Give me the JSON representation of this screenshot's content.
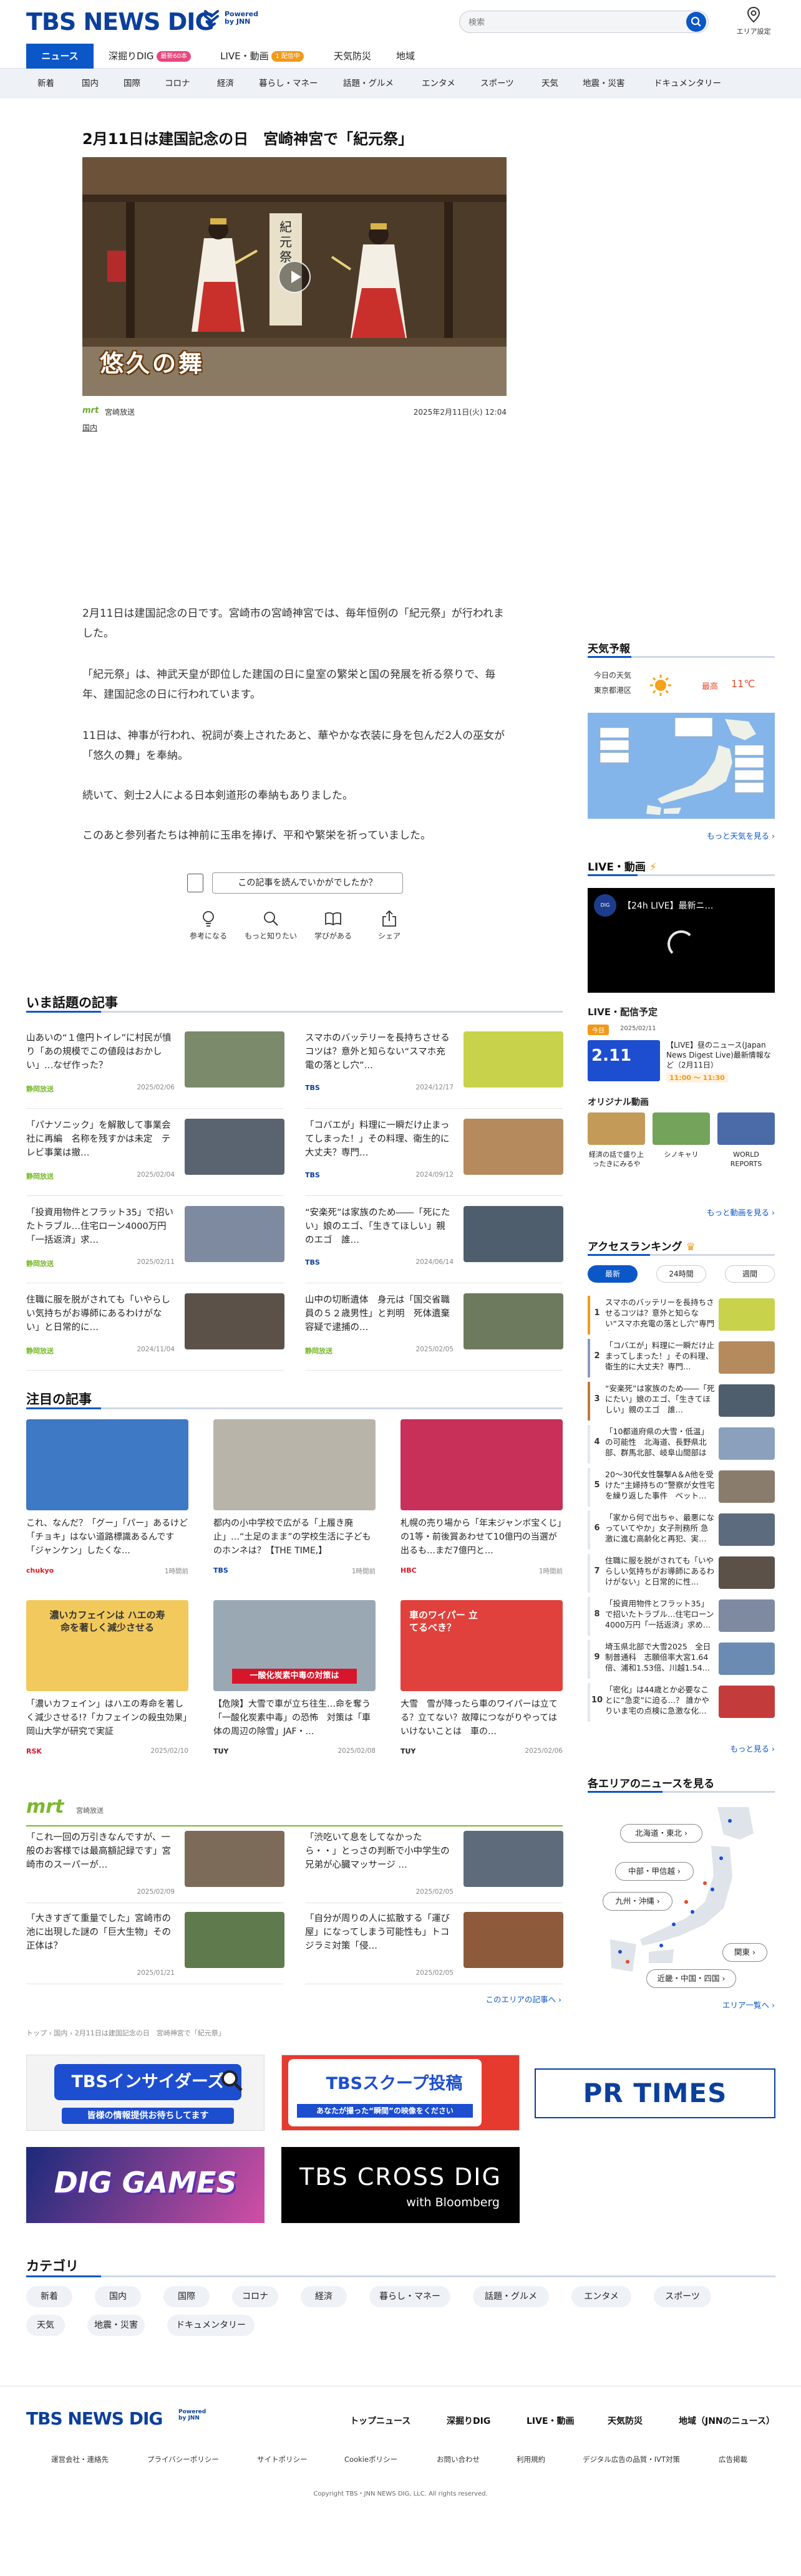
{
  "header": {
    "logo_text": "TBS NEWS DIG",
    "powered_by": "Powered by JNN",
    "search_placeholder": "検索",
    "area_label": "エリア設定"
  },
  "main_nav": [
    {
      "label": "ニュース"
    },
    {
      "label": "深掘りDIG",
      "badge": "最新60本",
      "badge_color": "#e8467c"
    },
    {
      "label": "LIVE・動画",
      "badge": "1 配信中",
      "badge_color": "#f09a1c"
    },
    {
      "label": "天気防災"
    },
    {
      "label": "地域"
    }
  ],
  "category_nav": [
    "新着",
    "国内",
    "国際",
    "コロナ",
    "経済",
    "暮らし・マネー",
    "話題・グルメ",
    "エンタメ",
    "スポーツ",
    "天気",
    "地震・災害",
    "ドキュメンタリー"
  ],
  "article": {
    "title": "2月11日は建国記念の日　宮崎神宮で「紀元祭」",
    "image_caption": "悠久の舞",
    "shrine_text": "紀元祭",
    "source": "宮崎放送",
    "source_logo": "mrt",
    "datetime": "2025年2月11日(火) 12:04",
    "tag": "国内",
    "paragraphs": [
      "2月11日は建国記念の日です。宮崎市の宮崎神宮では、毎年恒例の「紀元祭」が行われました。",
      "「紀元祭」は、神武天皇が即位した建国の日に皇室の繁栄と国の発展を祈る祭りで、毎年、建国記念の日に行われています。",
      "11日は、神事が行われ、祝詞が奏上されたあと、華やかな衣装に身を包んだ2人の巫女が「悠久の舞」を奉納。",
      "続いて、剣士2人による日本剣道形の奉納もありました。",
      "このあと参列者たちは神前に玉串を捧げ、平和や繁栄を祈っていました。"
    ],
    "feedback_prompt": "この記事を読んでいかがでしたか？",
    "reactions": [
      {
        "label": "参考になる",
        "icon": "lightbulb-icon"
      },
      {
        "label": "もっと知りたい",
        "icon": "search-icon"
      },
      {
        "label": "学びがある",
        "icon": "book-icon"
      },
      {
        "label": "シェア",
        "icon": "share-icon"
      }
    ]
  },
  "trending": {
    "heading": "いま話題の記事",
    "items": [
      {
        "title": "山あいの“１億円トイレ”に村民が憤り「あの規模でこの値段はおかしい」…なぜ作った？",
        "source": "静岡放送",
        "date": "2025/02/06",
        "color": "#7a8a6b"
      },
      {
        "title": "スマホのバッテリーを長持ちさせるコツは？意外と知らない“スマホ充電の落とし穴”…",
        "source": "TBS",
        "date": "2024/12/17",
        "color": "#c8d24a"
      },
      {
        "title": "「パナソニック」を解散して事業会社に再編　名称を残すかは未定　テレビ事業は撤…",
        "source": "静岡放送",
        "date": "2025/02/04",
        "color": "#5a6470"
      },
      {
        "title": "「コバエが」料理に一瞬だけ止まってしまった！」その料理、衛生的に大丈夫？専門…",
        "source": "TBS",
        "date": "2024/09/12",
        "color": "#b58a5c"
      },
      {
        "title": "「投資用物件とフラット35」で招いたトラブル…住宅ローン4000万円「一括返済」求…",
        "source": "静岡放送",
        "date": "2025/02/11",
        "color": "#7e8aa0"
      },
      {
        "title": "“安楽死”は家族のため――「死にたい」娘のエゴ、「生きてほしい」親のエゴ　誰…",
        "source": "TBS",
        "date": "2024/06/14",
        "color": "#4f5e6d"
      },
      {
        "title": "住職に服を脱がされても「いやらしい気持ちがお導師にあるわけがない」と日常的に…",
        "source": "静岡放送",
        "date": "2024/11/04",
        "color": "#5b5149"
      },
      {
        "title": "山中の切断遺体　身元は「国交省職員の５２歳男性」と判明　死体遺棄容疑で逮捕の…",
        "source": "静岡放送",
        "date": "2025/02/05",
        "color": "#6e7a5e"
      }
    ]
  },
  "featured": {
    "heading": "注目の記事",
    "items": [
      {
        "title": "これ、なんだ？「グー」「パー」あるけど「チョキ」はない道路標識あるんです「ジャンケン」したくな…",
        "source": "chukyo",
        "date": "1時間前",
        "color": "#3d79c4"
      },
      {
        "title": "都内の小中学校で広がる「上履き廃止」…“土足のまま”の学校生活に子どものホンネは？【THE TIME,】",
        "source": "TBS",
        "date": "1時間前",
        "color": "#b9b4aa"
      },
      {
        "title": "札幌の売り場から「年末ジャンボ宝くじ」の1等・前後賞あわせて10億円の当選が出るも…まだ7億円と…",
        "source": "HBC",
        "date": "1時間前",
        "color": "#c8305a"
      },
      {
        "title": "「濃いカフェイン」はハエの寿命を著しく減少させる!?「カフェインの殺虫効果」岡山大学が研究で実証",
        "source": "RSK",
        "date": "2025/02/10",
        "color": "#f2c95c"
      },
      {
        "title": "【危険】大雪で車が立ち往生…命を奪う「一酸化炭素中毒」の恐怖　対策は「車体の周辺の除雪」JAF・…",
        "source": "TUY",
        "date": "2025/02/08",
        "color": "#9aa8b3"
      },
      {
        "title": "大雪　雪が降ったら車のワイパーは立てる？立てない？故障につながりやってはいけないことは　車の…",
        "source": "TUY",
        "date": "2025/02/06",
        "color": "#e1413c"
      }
    ],
    "card1_caption": "濃いカフェインは ハエの寿命を著しく減少させる",
    "card2_caption": "一酸化炭素中毒の対策は",
    "card3_caption": "車のワイパー 立てるべき？"
  },
  "local": {
    "station": "宮崎放送",
    "station_logo": "mrt",
    "items": [
      {
        "title": "「これ一回の万引きなんですが、一般のお客様では最高額記録です」宮崎市のスーパーが…",
        "date": "2025/02/09",
        "color": "#7d6b5a"
      },
      {
        "title": "「渋吃いて息をしてなかったら・・」とっさの判断で小中学生の兄弟が心臓マッサージ …",
        "date": "2025/02/05",
        "color": "#5e6b7a"
      },
      {
        "title": "「大きすぎて重量でした」宮崎市の池に出現した謎の「巨大生物」その正体は？",
        "date": "2025/01/21",
        "color": "#5f7a4d"
      },
      {
        "title": "「自分が周りの人に拡散する「運び屋」になってしまう可能性も」トコジラミ対策「侵…",
        "date": "2025/02/05",
        "color": "#8d5b3c"
      }
    ],
    "more": "このエリアの記事へ"
  },
  "breadcrumb": [
    "トップ",
    "国内",
    "2月11日は建国記念の日　宮崎神宮で「紀元祭」"
  ],
  "banners": [
    {
      "name": "TBSインサイダーズ",
      "sub": "皆様の情報提供お待ちしてます"
    },
    {
      "name": "TBSスクープ投稿",
      "sub": "あなたが撮った“瞬間”の映像をください"
    },
    {
      "name": "PR TIMES"
    },
    {
      "name": "DIG GAMES"
    },
    {
      "name": "TBS CROSS DIG",
      "sub": "with Bloomberg"
    }
  ],
  "categories_section": {
    "heading": "カテゴリ",
    "items": [
      "新着",
      "国内",
      "国際",
      "コロナ",
      "経済",
      "暮らし・マネー",
      "話題・グルメ",
      "エンタメ",
      "スポーツ",
      "天気",
      "地震・災害",
      "ドキュメンタリー"
    ]
  },
  "sidebar": {
    "weather": {
      "heading": "天気予報",
      "today_label": "今日の天気",
      "region": "東京都港区",
      "max_label": "最高",
      "max_temp": "11℃",
      "more": "もっと天気を見る"
    },
    "live": {
      "heading": "LIVE・動画",
      "stream_title": "【24h LIVE】最新ニ…",
      "schedule_heading": "LIVE・配信予定",
      "schedule_tag": "今日",
      "schedule_date": "2025/02/11",
      "big_date": "2.11",
      "program": "【LIVE】昼のニュース(Japan News Digest Live)最新情報など（2月11日）",
      "program_time": "11:00 〜 11:30",
      "original_heading": "オリジナル動画",
      "originals": [
        {
          "title": "経済の話で盛り上ったきにみるや",
          "color": "#c49a58"
        },
        {
          "title": "シノキャリ",
          "color": "#74a35b"
        },
        {
          "title": "WORLD REPORTS",
          "color": "#4b6aa8"
        }
      ],
      "more": "もっと動画を見る"
    },
    "ranking": {
      "heading": "アクセスランキング",
      "tabs": [
        "最新",
        "24時間",
        "週間"
      ],
      "items": [
        {
          "rank": "1",
          "title": "スマホのバッテリーを長持ちさせるコツは？意外と知らない“スマホ充電の落とし穴”専門家…",
          "color": "#c8d24a"
        },
        {
          "rank": "2",
          "title": "「コバエが」料理に一瞬だけ止まってしまった！」その料理、衛生的に大丈夫？専門…",
          "color": "#b58a5c"
        },
        {
          "rank": "3",
          "title": "“安楽死”は家族のため――「死にたい」娘のエゴ、「生きてほしい」親のエゴ　誰…",
          "color": "#4f5e6d"
        },
        {
          "rank": "4",
          "title": "「10都道府県の大雪・低温」の可能性　北海道、長野県北部、群馬北部、岐阜山間部は大…",
          "color": "#8ba0bd"
        },
        {
          "rank": "5",
          "title": "20〜30代女性襲撃A＆A他を受けた“主婦持ちの”警察が女性宅を繰り返した事件　ベット…",
          "color": "#8a7c6c"
        },
        {
          "rank": "6",
          "title": "「家から何で出ちゃ、最悪になっていてやか」女子刑務所 急激に進む高齢化と再犯、実…",
          "color": "#5c6c7e"
        },
        {
          "rank": "7",
          "title": "住職に服を脱がされても「いやらしい気持ちがお導師にあるわけがない」と日常的に性…",
          "color": "#5b5149"
        },
        {
          "rank": "8",
          "title": "「投資用物件とフラット35」で招いたトラブル…住宅ローン4000万円「一括返済」求め…",
          "color": "#7e8aa0"
        },
        {
          "rank": "9",
          "title": "埼玉県北部で大雪2025　全日制普通科　志願倍率大宮1.64倍、浦和1.53倍、川越1.54…",
          "color": "#6b8bb3"
        },
        {
          "rank": "10",
          "title": "「密化」は44歳とか必要なことに“急変”に迫る…？ 誰かやりいま宅の点検に急激な化…",
          "color": "#c43b3b"
        }
      ],
      "more": "もっと見る"
    },
    "areas": {
      "heading": "各エリアのニュースを見る",
      "items": [
        "北海道・東北",
        "中部・甲信越",
        "九州・沖縄",
        "関東",
        "近畿・中国・四国"
      ],
      "more": "エリア一覧へ"
    }
  },
  "footer": {
    "logo_text": "TBS NEWS DIG",
    "powered_by": "Powered by JNN",
    "main_links": [
      "トップニュース",
      "深掘りDIG",
      "LIVE・動画",
      "天気防災",
      "地域（JNNのニュース）"
    ],
    "sub_links": [
      "運営会社・連絡先",
      "プライバシーポリシー",
      "サイトポリシー",
      "Cookieポリシー",
      "お問い合わせ",
      "利用規約",
      "デジタル広告の品質・IVT対策",
      "広告掲載"
    ],
    "copyright": "Copyright TBS・JNN NEWS DIG, LLC. All rights reserved."
  },
  "colors": {
    "brand": "#0b3f9c",
    "accent": "#0b57c7",
    "nav_bg": "#eef1f6"
  }
}
